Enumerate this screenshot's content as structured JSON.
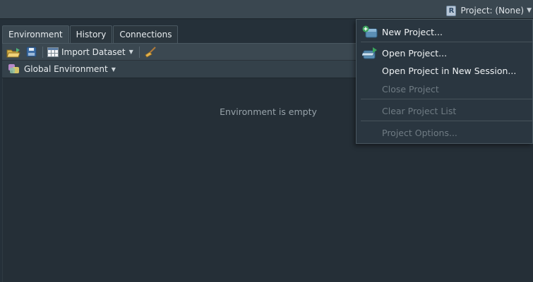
{
  "topbar": {
    "project_label": "Project: (None)",
    "project_icon": "r-project-icon"
  },
  "tabs": [
    {
      "label": "Environment",
      "active": true
    },
    {
      "label": "History",
      "active": false
    },
    {
      "label": "Connections",
      "active": false
    }
  ],
  "toolbar": {
    "import_dataset_label": "Import Dataset",
    "icons": [
      "load-workspace-icon",
      "save-workspace-icon",
      "import-dataset-icon",
      "broom-icon"
    ]
  },
  "environment": {
    "scope_label": "Global Environment",
    "empty_message": "Environment is empty"
  },
  "project_menu": {
    "items": [
      {
        "label": "New Project...",
        "icon": "new-project-icon",
        "enabled": true
      },
      {
        "label": "Open Project...",
        "icon": "open-project-icon",
        "enabled": true
      },
      {
        "label": "Open Project in New Session...",
        "icon": "",
        "enabled": true
      },
      {
        "label": "Close Project",
        "icon": "",
        "enabled": false
      },
      {
        "label": "Clear Project List",
        "icon": "",
        "enabled": false
      },
      {
        "label": "Project Options...",
        "icon": "",
        "enabled": false
      }
    ]
  },
  "colors": {
    "background": "#253039",
    "toolbar": "#3b4851",
    "menu_background": "#2a3640",
    "disabled_text": "#6f7b83"
  }
}
